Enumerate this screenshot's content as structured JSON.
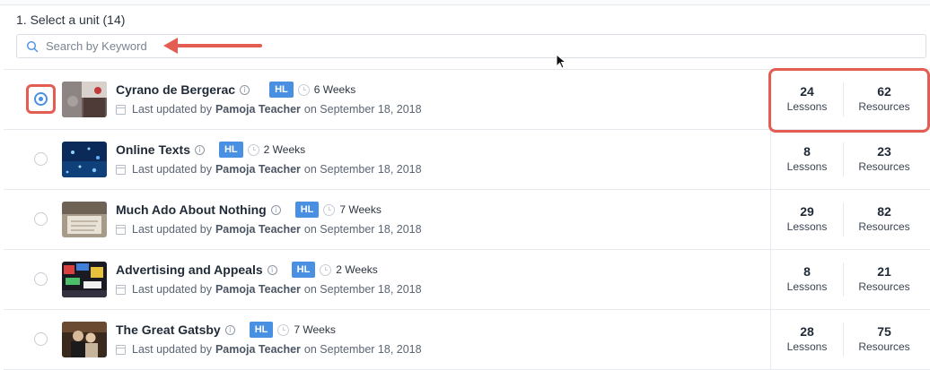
{
  "header": {
    "title": "1. Select a unit (14)"
  },
  "search": {
    "placeholder": "Search by Keyword",
    "value": ""
  },
  "units": [
    {
      "title": "Cyrano de Bergerac",
      "level": "HL",
      "duration": "6 Weeks",
      "updated_prefix": "Last updated by",
      "author": "Pamoja Teacher",
      "date": "on September 18, 2018",
      "lessons": "24",
      "lessons_label": "Lessons",
      "resources": "62",
      "resources_label": "Resources",
      "selected": true
    },
    {
      "title": "Online Texts",
      "level": "HL",
      "duration": "2 Weeks",
      "updated_prefix": "Last updated by",
      "author": "Pamoja Teacher",
      "date": "on September 18, 2018",
      "lessons": "8",
      "lessons_label": "Lessons",
      "resources": "23",
      "resources_label": "Resources",
      "selected": false
    },
    {
      "title": "Much Ado About Nothing",
      "level": "HL",
      "duration": "7 Weeks",
      "updated_prefix": "Last updated by",
      "author": "Pamoja Teacher",
      "date": "on September 18, 2018",
      "lessons": "29",
      "lessons_label": "Lessons",
      "resources": "82",
      "resources_label": "Resources",
      "selected": false
    },
    {
      "title": "Advertising and Appeals",
      "level": "HL",
      "duration": "2 Weeks",
      "updated_prefix": "Last updated by",
      "author": "Pamoja Teacher",
      "date": "on September 18, 2018",
      "lessons": "8",
      "lessons_label": "Lessons",
      "resources": "21",
      "resources_label": "Resources",
      "selected": false
    },
    {
      "title": "The Great Gatsby",
      "level": "HL",
      "duration": "7 Weeks",
      "updated_prefix": "Last updated by",
      "author": "Pamoja Teacher",
      "date": "on September 18, 2018",
      "lessons": "28",
      "lessons_label": "Lessons",
      "resources": "75",
      "resources_label": "Resources",
      "selected": false
    }
  ],
  "colors": {
    "accent": "#4a90e2",
    "annotation": "#e35d52"
  },
  "icons": {
    "search": "search-icon",
    "info": "info-icon",
    "clock": "clock-icon",
    "calendar": "calendar-icon"
  }
}
